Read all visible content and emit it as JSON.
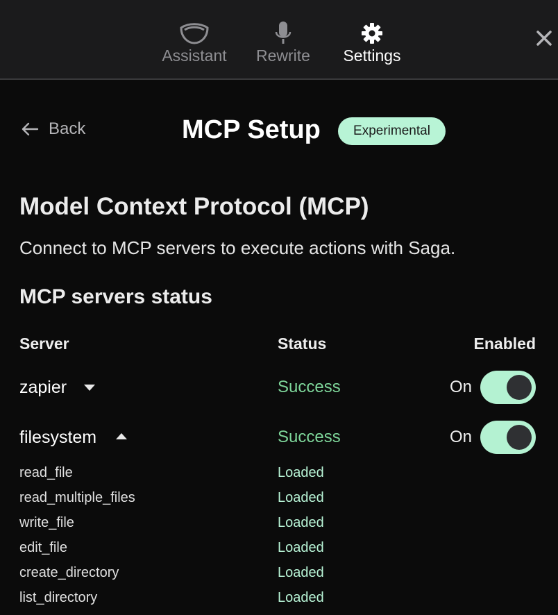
{
  "tabs": [
    {
      "label": "Assistant",
      "icon": "assistant-icon",
      "active": false
    },
    {
      "label": "Rewrite",
      "icon": "microphone-icon",
      "active": false
    },
    {
      "label": "Settings",
      "icon": "gear-icon",
      "active": true
    }
  ],
  "header": {
    "back_label": "Back",
    "title": "MCP Setup",
    "badge": "Experimental"
  },
  "intro": {
    "heading": "Model Context Protocol (MCP)",
    "description": "Connect to MCP servers to execute actions with Saga."
  },
  "servers_section": {
    "heading": "MCP servers status",
    "columns": {
      "server": "Server",
      "status": "Status",
      "enabled": "Enabled"
    },
    "servers": [
      {
        "name": "zapier",
        "status": "Success",
        "enabled_label": "On",
        "expanded": false
      },
      {
        "name": "filesystem",
        "status": "Success",
        "enabled_label": "On",
        "expanded": true
      }
    ],
    "tools": [
      {
        "name": "read_file",
        "status": "Loaded"
      },
      {
        "name": "read_multiple_files",
        "status": "Loaded"
      },
      {
        "name": "write_file",
        "status": "Loaded"
      },
      {
        "name": "edit_file",
        "status": "Loaded"
      },
      {
        "name": "create_directory",
        "status": "Loaded"
      },
      {
        "name": "list_directory",
        "status": "Loaded"
      }
    ]
  },
  "colors": {
    "accent": "#b8f4d6",
    "success": "#7ed69a",
    "background": "#0b0b0b",
    "topbar": "#1b1b1c"
  }
}
